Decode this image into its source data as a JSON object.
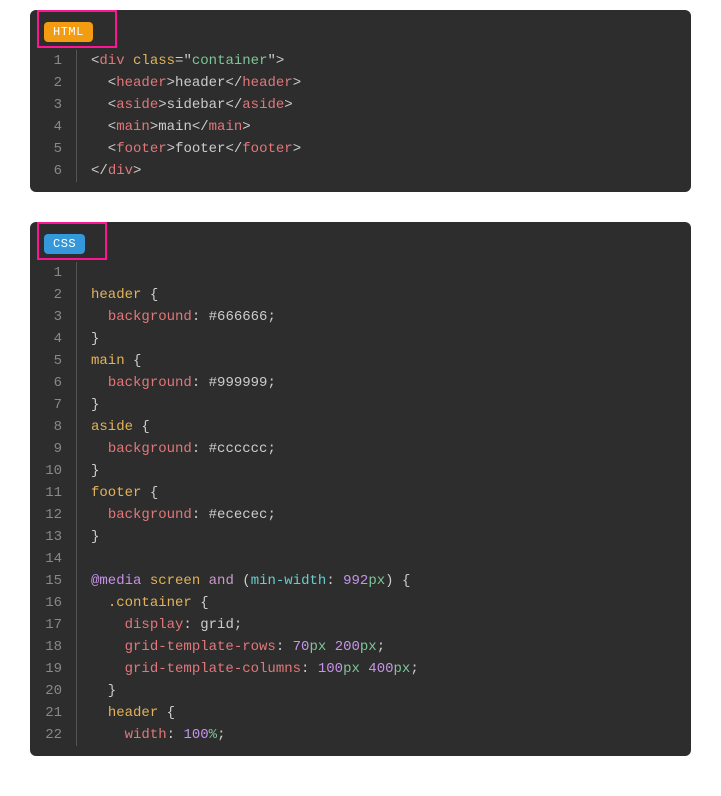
{
  "blocks": [
    {
      "id": "html",
      "label": "HTML",
      "badge_class": "lang-html-badge",
      "language": "html",
      "highlight_box": true,
      "lines": [
        {
          "n": 1,
          "segments": [
            [
              "<",
              "punct"
            ],
            [
              "div",
              "tag"
            ],
            [
              " ",
              "punct"
            ],
            [
              "class",
              "attr"
            ],
            [
              "=\"",
              "punct"
            ],
            [
              "container",
              "string"
            ],
            [
              "\"",
              "punct"
            ],
            [
              ">",
              "punct"
            ]
          ]
        },
        {
          "n": 2,
          "segments": [
            [
              "  <",
              "punct"
            ],
            [
              "header",
              "tag"
            ],
            [
              ">",
              "punct"
            ],
            [
              "header",
              "val"
            ],
            [
              "</",
              "punct"
            ],
            [
              "header",
              "tag"
            ],
            [
              ">",
              "punct"
            ]
          ]
        },
        {
          "n": 3,
          "segments": [
            [
              "  <",
              "punct"
            ],
            [
              "aside",
              "tag"
            ],
            [
              ">",
              "punct"
            ],
            [
              "sidebar",
              "val"
            ],
            [
              "</",
              "punct"
            ],
            [
              "aside",
              "tag"
            ],
            [
              ">",
              "punct"
            ]
          ]
        },
        {
          "n": 4,
          "segments": [
            [
              "  <",
              "punct"
            ],
            [
              "main",
              "tag"
            ],
            [
              ">",
              "punct"
            ],
            [
              "main",
              "val"
            ],
            [
              "</",
              "punct"
            ],
            [
              "main",
              "tag"
            ],
            [
              ">",
              "punct"
            ]
          ]
        },
        {
          "n": 5,
          "segments": [
            [
              "  <",
              "punct"
            ],
            [
              "footer",
              "tag"
            ],
            [
              ">",
              "punct"
            ],
            [
              "footer",
              "val"
            ],
            [
              "</",
              "punct"
            ],
            [
              "footer",
              "tag"
            ],
            [
              ">",
              "punct"
            ]
          ]
        },
        {
          "n": 6,
          "segments": [
            [
              "</",
              "punct"
            ],
            [
              "div",
              "tag"
            ],
            [
              ">",
              "punct"
            ]
          ]
        }
      ]
    },
    {
      "id": "css",
      "label": "CSS",
      "badge_class": "lang-css-badge",
      "language": "css",
      "highlight_box": true,
      "lines": [
        {
          "n": 1,
          "segments": []
        },
        {
          "n": 2,
          "segments": [
            [
              "header",
              "sel"
            ],
            [
              " {",
              "punct"
            ]
          ]
        },
        {
          "n": 3,
          "segments": [
            [
              "  ",
              "punct"
            ],
            [
              "background",
              "prop"
            ],
            [
              ": ",
              "punct"
            ],
            [
              "#666666",
              "val"
            ],
            [
              ";",
              "punct"
            ]
          ]
        },
        {
          "n": 4,
          "segments": [
            [
              "}",
              "punct"
            ]
          ]
        },
        {
          "n": 5,
          "segments": [
            [
              "main",
              "sel"
            ],
            [
              " {",
              "punct"
            ]
          ]
        },
        {
          "n": 6,
          "segments": [
            [
              "  ",
              "punct"
            ],
            [
              "background",
              "prop"
            ],
            [
              ": ",
              "punct"
            ],
            [
              "#999999",
              "val"
            ],
            [
              ";",
              "punct"
            ]
          ]
        },
        {
          "n": 7,
          "segments": [
            [
              "}",
              "punct"
            ]
          ]
        },
        {
          "n": 8,
          "segments": [
            [
              "aside",
              "sel"
            ],
            [
              " {",
              "punct"
            ]
          ]
        },
        {
          "n": 9,
          "segments": [
            [
              "  ",
              "punct"
            ],
            [
              "background",
              "prop"
            ],
            [
              ": ",
              "punct"
            ],
            [
              "#cccccc",
              "val"
            ],
            [
              ";",
              "punct"
            ]
          ]
        },
        {
          "n": 10,
          "segments": [
            [
              "}",
              "punct"
            ]
          ]
        },
        {
          "n": 11,
          "segments": [
            [
              "footer",
              "sel"
            ],
            [
              " {",
              "punct"
            ]
          ]
        },
        {
          "n": 12,
          "segments": [
            [
              "  ",
              "punct"
            ],
            [
              "background",
              "prop"
            ],
            [
              ": ",
              "punct"
            ],
            [
              "#ececec",
              "val"
            ],
            [
              ";",
              "punct"
            ]
          ]
        },
        {
          "n": 13,
          "segments": [
            [
              "}",
              "punct"
            ]
          ]
        },
        {
          "n": 14,
          "segments": []
        },
        {
          "n": 15,
          "segments": [
            [
              "@media",
              "at"
            ],
            [
              " ",
              "punct"
            ],
            [
              "screen",
              "media"
            ],
            [
              " ",
              "punct"
            ],
            [
              "and",
              "keyword"
            ],
            [
              " (",
              "punct"
            ],
            [
              "min-width",
              "cond"
            ],
            [
              ": ",
              "punct"
            ],
            [
              "992",
              "num"
            ],
            [
              "px",
              "unit"
            ],
            [
              ") {",
              "punct"
            ]
          ]
        },
        {
          "n": 16,
          "segments": [
            [
              "  ",
              "punct"
            ],
            [
              ".container",
              "sel"
            ],
            [
              " {",
              "punct"
            ]
          ]
        },
        {
          "n": 17,
          "segments": [
            [
              "    ",
              "punct"
            ],
            [
              "display",
              "prop"
            ],
            [
              ": ",
              "punct"
            ],
            [
              "grid",
              "val"
            ],
            [
              ";",
              "punct"
            ]
          ]
        },
        {
          "n": 18,
          "segments": [
            [
              "    ",
              "punct"
            ],
            [
              "grid-template-rows",
              "prop"
            ],
            [
              ": ",
              "punct"
            ],
            [
              "70",
              "num"
            ],
            [
              "px",
              "unit"
            ],
            [
              " ",
              "punct"
            ],
            [
              "200",
              "num"
            ],
            [
              "px",
              "unit"
            ],
            [
              ";",
              "punct"
            ]
          ]
        },
        {
          "n": 19,
          "segments": [
            [
              "    ",
              "punct"
            ],
            [
              "grid-template-columns",
              "prop"
            ],
            [
              ": ",
              "punct"
            ],
            [
              "100",
              "num"
            ],
            [
              "px",
              "unit"
            ],
            [
              " ",
              "punct"
            ],
            [
              "400",
              "num"
            ],
            [
              "px",
              "unit"
            ],
            [
              ";",
              "punct"
            ]
          ]
        },
        {
          "n": 20,
          "segments": [
            [
              "  }",
              "punct"
            ]
          ]
        },
        {
          "n": 21,
          "segments": [
            [
              "  ",
              "punct"
            ],
            [
              "header",
              "sel"
            ],
            [
              " {",
              "punct"
            ]
          ]
        },
        {
          "n": 22,
          "segments": [
            [
              "    ",
              "punct"
            ],
            [
              "width",
              "prop"
            ],
            [
              ": ",
              "punct"
            ],
            [
              "100",
              "num"
            ],
            [
              "%",
              "unit"
            ],
            [
              ";",
              "punct"
            ]
          ]
        }
      ]
    }
  ]
}
